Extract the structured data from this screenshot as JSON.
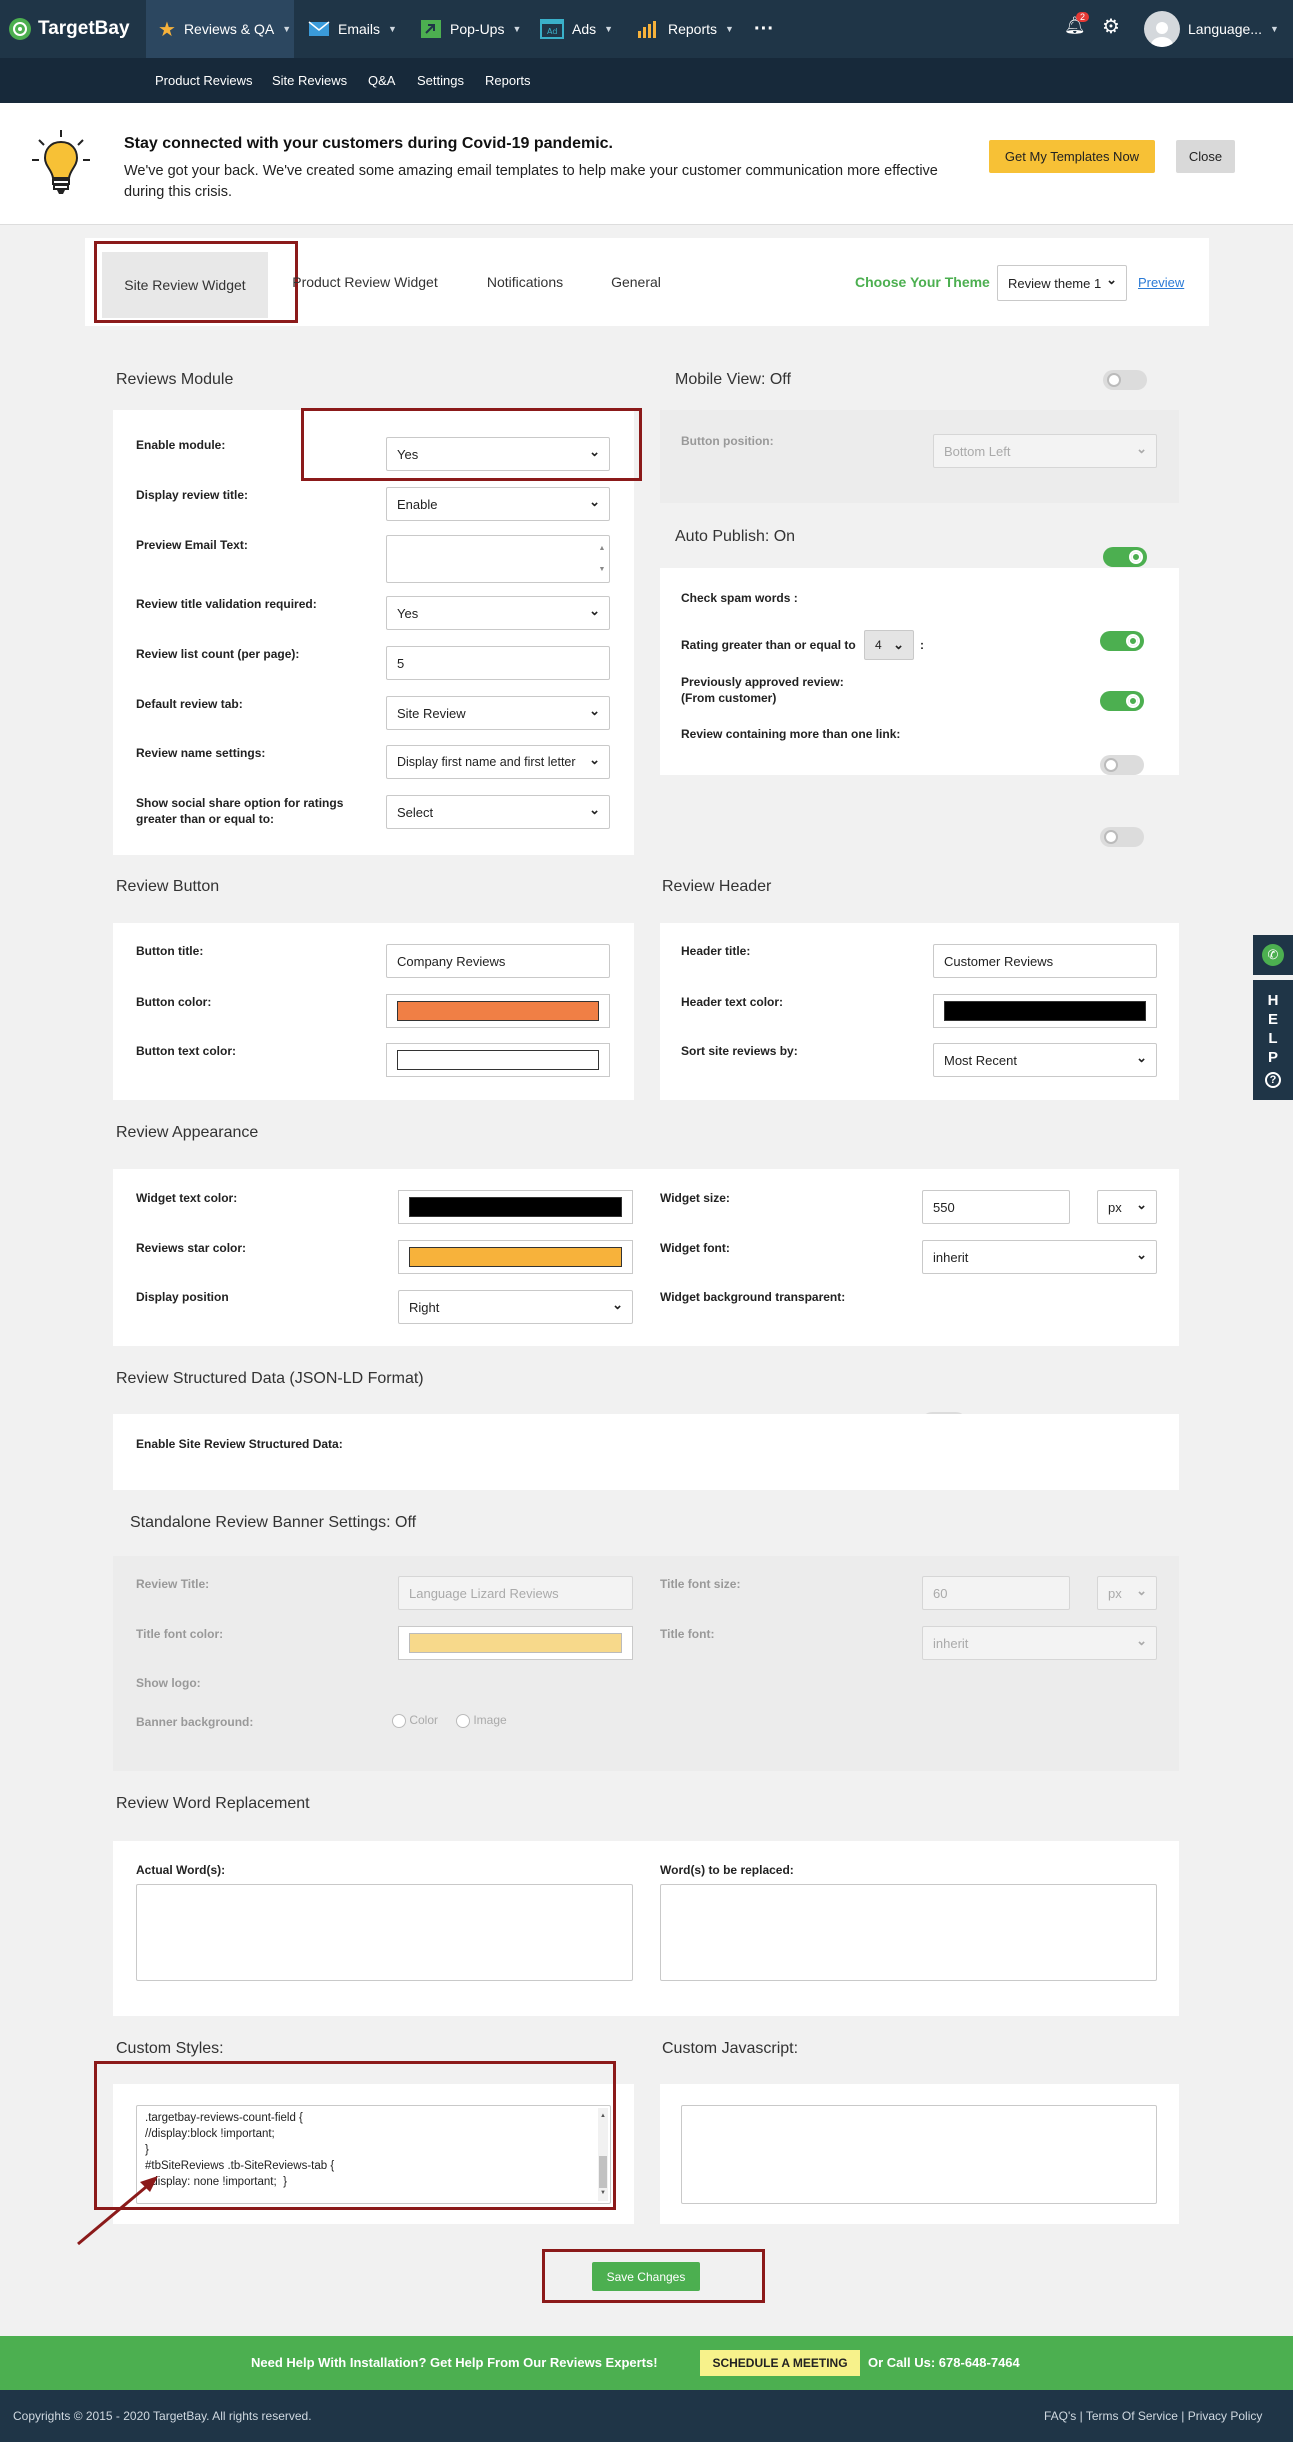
{
  "brand": {
    "name": "TargetBay"
  },
  "nav": {
    "items": [
      {
        "label": "Reviews & QA"
      },
      {
        "label": "Emails"
      },
      {
        "label": "Pop-Ups"
      },
      {
        "label": "Ads"
      },
      {
        "label": "Reports"
      }
    ],
    "more": "···",
    "notification_count": "2",
    "user": "Language..."
  },
  "subnav": [
    "Product Reviews",
    "Site Reviews",
    "Q&A",
    "Settings",
    "Reports"
  ],
  "banner": {
    "title": "Stay connected with your customers during Covid-19 pandemic.",
    "text": "We've got your back. We've created some amazing email templates to help make your customer communication more effective during this crisis.",
    "cta": "Get My Templates Now",
    "close": "Close"
  },
  "tabs": [
    "Site Review Widget",
    "Product Review Widget",
    "Notifications",
    "General"
  ],
  "theme": {
    "label": "Choose Your Theme",
    "value": "Review theme 1",
    "preview": "Preview"
  },
  "reviews_module": {
    "title": "Reviews Module",
    "enable_module": {
      "label": "Enable module:",
      "value": "Yes"
    },
    "display_review_title": {
      "label": "Display review title:",
      "value": "Enable"
    },
    "preview_email_text": {
      "label": "Preview Email Text:",
      "value": ""
    },
    "title_validation": {
      "label": "Review title validation required:",
      "value": "Yes"
    },
    "list_count": {
      "label": "Review list count (per page):",
      "value": "5"
    },
    "default_tab": {
      "label": "Default review tab:",
      "value": "Site Review"
    },
    "name_settings": {
      "label": "Review name settings:",
      "value": "Display first name and first letter"
    },
    "social_share": {
      "label": "Show social share option for ratings greater than or equal to:",
      "value": "Select"
    }
  },
  "mobile_view": {
    "title": "Mobile View: Off",
    "button_position_label": "Button position:",
    "button_position_value": "Bottom Left"
  },
  "auto_publish": {
    "title": "Auto Publish: On",
    "spam": "Check spam words :",
    "rating": "Rating greater than or equal to",
    "rating_value": "4",
    "rating_colon": ":",
    "approved": "Previously approved review:\n(From customer)",
    "links": "Review containing more than one link:"
  },
  "review_button": {
    "title": "Review Button",
    "button_title": {
      "label": "Button title:",
      "value": "Company Reviews"
    },
    "button_color": {
      "label": "Button color:",
      "color": "#f07f45"
    },
    "button_text_color": {
      "label": "Button text color:",
      "color": "#ffffff"
    }
  },
  "review_header": {
    "title": "Review Header",
    "header_title": {
      "label": "Header title:",
      "value": "Customer Reviews"
    },
    "header_text_color": {
      "label": "Header text color:",
      "color": "#000000"
    },
    "sort": {
      "label": "Sort site reviews by:",
      "value": "Most Recent"
    }
  },
  "appearance": {
    "title": "Review Appearance",
    "text_color": {
      "label": "Widget text color:",
      "color": "#000000"
    },
    "star_color": {
      "label": "Reviews star color:",
      "color": "#f7b23b"
    },
    "position": {
      "label": "Display position",
      "value": "Right"
    },
    "size": {
      "label": "Widget size:",
      "value": "550",
      "unit": "px"
    },
    "font": {
      "label": "Widget font:",
      "value": "inherit"
    },
    "transparent": {
      "label": "Widget background transparent:"
    }
  },
  "structured": {
    "title": "Review Structured Data (JSON-LD Format)",
    "label": "Enable Site Review Structured Data:"
  },
  "standalone": {
    "title": "Standalone Review Banner Settings: Off",
    "review_title": {
      "label": "Review Title:",
      "value": "Language Lizard Reviews"
    },
    "title_font_size": {
      "label": "Title font size:",
      "value": "60",
      "unit": "px"
    },
    "title_font_color": {
      "label": "Title font color:",
      "color": "#f7d98b"
    },
    "title_font": {
      "label": "Title font:",
      "value": "inherit"
    },
    "show_logo": {
      "label": "Show logo:"
    },
    "banner_bg": {
      "label": "Banner background:",
      "opt1": "Color",
      "opt2": "Image"
    }
  },
  "word_replacement": {
    "title": "Review Word Replacement",
    "actual": "Actual Word(s):",
    "replaced": "Word(s) to be replaced:"
  },
  "custom_styles": {
    "title": "Custom Styles:",
    "lines": [
      ".targetbay-reviews-count-field {",
      "//display:block !important;",
      "}",
      "#tbSiteReviews .tb-SiteReviews-tab {",
      "  display: none !important;  }"
    ]
  },
  "custom_js": {
    "title": "Custom Javascript:"
  },
  "save": "Save Changes",
  "footer": {
    "help": "Need Help With Installation? Get Help From Our Reviews Experts!",
    "schedule": "SCHEDULE A MEETING",
    "call": "Or Call Us: 678-648-7464",
    "copyright": "Copyrights © 2015 - 2020 TargetBay. All rights reserved.",
    "links": [
      "FAQ's",
      "Terms Of Service",
      "Privacy Policy"
    ]
  },
  "help_tab": "HELP",
  "colors": {
    "nav": "#1f3547",
    "accent_green": "#4caf50",
    "highlight_red": "#8b1a1a",
    "cta_yellow": "#f7c136"
  }
}
